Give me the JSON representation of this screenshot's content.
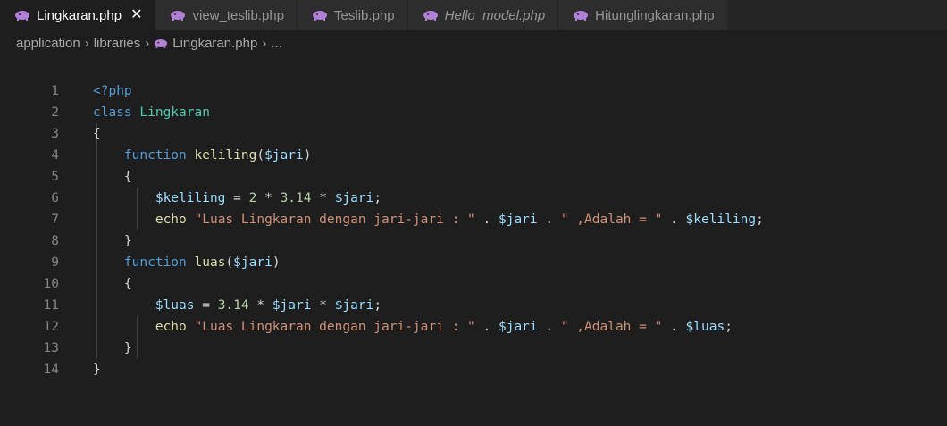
{
  "tabs": [
    {
      "label": "Lingkaran.php",
      "active": true,
      "italic": false,
      "close": "✕"
    },
    {
      "label": "view_teslib.php",
      "active": false,
      "italic": false
    },
    {
      "label": "Teslib.php",
      "active": false,
      "italic": false
    },
    {
      "label": "Hello_model.php",
      "active": false,
      "italic": true
    },
    {
      "label": "Hitunglingkaran.php",
      "active": false,
      "italic": false
    }
  ],
  "breadcrumb": {
    "parts": [
      "application",
      "libraries",
      "Lingkaran.php",
      "..."
    ]
  },
  "colors": {
    "php_icon": "#b180d7",
    "keyword": "#569cd6",
    "class_name": "#4ec9b0",
    "function_name": "#dcdcaa",
    "variable": "#9cdcfe",
    "number": "#b5cea8",
    "string": "#ce9178"
  },
  "code": {
    "lines": [
      {
        "num": "1",
        "tokens": [
          {
            "t": "tag",
            "v": "<?php"
          }
        ]
      },
      {
        "num": "2",
        "tokens": [
          {
            "t": "kw",
            "v": "class "
          },
          {
            "t": "cls",
            "v": "Lingkaran"
          }
        ]
      },
      {
        "num": "3",
        "tokens": [
          {
            "t": "brace",
            "v": "{"
          }
        ]
      },
      {
        "num": "4",
        "tokens": [
          {
            "t": "plain",
            "v": "    "
          },
          {
            "t": "kw",
            "v": "function "
          },
          {
            "t": "fn",
            "v": "keliling"
          },
          {
            "t": "plain",
            "v": "("
          },
          {
            "t": "var",
            "v": "$jari"
          },
          {
            "t": "plain",
            "v": ")"
          }
        ]
      },
      {
        "num": "5",
        "tokens": [
          {
            "t": "plain",
            "v": "    "
          },
          {
            "t": "brace",
            "v": "{"
          }
        ]
      },
      {
        "num": "6",
        "tokens": [
          {
            "t": "plain",
            "v": "        "
          },
          {
            "t": "var",
            "v": "$keliling"
          },
          {
            "t": "plain",
            "v": " = "
          },
          {
            "t": "num",
            "v": "2"
          },
          {
            "t": "plain",
            "v": " * "
          },
          {
            "t": "num",
            "v": "3.14"
          },
          {
            "t": "plain",
            "v": " * "
          },
          {
            "t": "var",
            "v": "$jari"
          },
          {
            "t": "plain",
            "v": ";"
          }
        ]
      },
      {
        "num": "7",
        "tokens": [
          {
            "t": "plain",
            "v": "        "
          },
          {
            "t": "fn",
            "v": "echo "
          },
          {
            "t": "str",
            "v": "\"Luas Lingkaran dengan jari-jari : \""
          },
          {
            "t": "plain",
            "v": " . "
          },
          {
            "t": "var",
            "v": "$jari"
          },
          {
            "t": "plain",
            "v": " . "
          },
          {
            "t": "str",
            "v": "\" ,Adalah = \""
          },
          {
            "t": "plain",
            "v": " . "
          },
          {
            "t": "var",
            "v": "$keliling"
          },
          {
            "t": "plain",
            "v": ";"
          }
        ]
      },
      {
        "num": "8",
        "tokens": [
          {
            "t": "plain",
            "v": "    "
          },
          {
            "t": "brace",
            "v": "}"
          }
        ]
      },
      {
        "num": "9",
        "tokens": [
          {
            "t": "plain",
            "v": "    "
          },
          {
            "t": "kw",
            "v": "function "
          },
          {
            "t": "fn",
            "v": "luas"
          },
          {
            "t": "plain",
            "v": "("
          },
          {
            "t": "var",
            "v": "$jari"
          },
          {
            "t": "plain",
            "v": ")"
          }
        ]
      },
      {
        "num": "10",
        "tokens": [
          {
            "t": "plain",
            "v": "    "
          },
          {
            "t": "brace",
            "v": "{"
          }
        ]
      },
      {
        "num": "11",
        "tokens": [
          {
            "t": "plain",
            "v": "        "
          },
          {
            "t": "var",
            "v": "$luas"
          },
          {
            "t": "plain",
            "v": " = "
          },
          {
            "t": "num",
            "v": "3.14"
          },
          {
            "t": "plain",
            "v": " * "
          },
          {
            "t": "var",
            "v": "$jari"
          },
          {
            "t": "plain",
            "v": " * "
          },
          {
            "t": "var",
            "v": "$jari"
          },
          {
            "t": "plain",
            "v": ";"
          }
        ]
      },
      {
        "num": "12",
        "tokens": [
          {
            "t": "plain",
            "v": "        "
          },
          {
            "t": "fn",
            "v": "echo "
          },
          {
            "t": "str",
            "v": "\"Luas Lingkaran dengan jari-jari : \""
          },
          {
            "t": "plain",
            "v": " . "
          },
          {
            "t": "var",
            "v": "$jari"
          },
          {
            "t": "plain",
            "v": " . "
          },
          {
            "t": "str",
            "v": "\" ,Adalah = \""
          },
          {
            "t": "plain",
            "v": " . "
          },
          {
            "t": "var",
            "v": "$luas"
          },
          {
            "t": "plain",
            "v": ";"
          }
        ]
      },
      {
        "num": "13",
        "tokens": [
          {
            "t": "plain",
            "v": "    "
          },
          {
            "t": "brace",
            "v": "}"
          }
        ]
      },
      {
        "num": "14",
        "tokens": [
          {
            "t": "brace",
            "v": "}"
          }
        ]
      }
    ]
  }
}
